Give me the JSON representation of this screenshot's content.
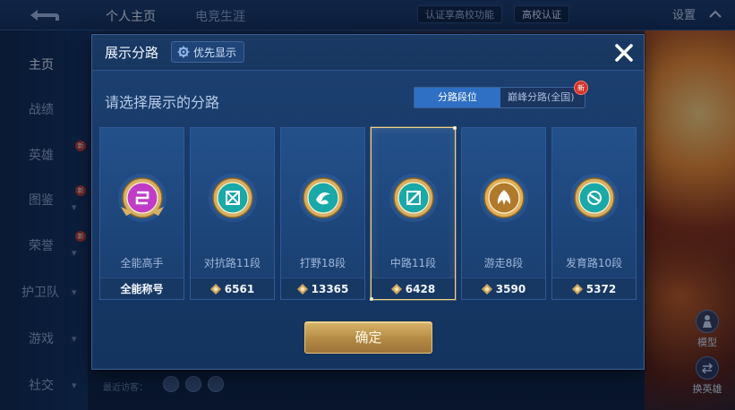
{
  "topbar": {
    "tabs": [
      "个人主页",
      "电竞生涯"
    ],
    "campus_promo": "认证享高校功能",
    "campus_cert": "高校认证",
    "settings": "设置"
  },
  "sidebar": {
    "items": [
      {
        "label": "主页"
      },
      {
        "label": "战绩"
      },
      {
        "label": "英雄",
        "badge": "新"
      },
      {
        "label": "图鉴",
        "badge": "新"
      },
      {
        "label": "荣誉",
        "badge": "新"
      },
      {
        "label": "护卫队"
      },
      {
        "label": "游戏"
      },
      {
        "label": "社交"
      }
    ]
  },
  "visitors": {
    "label": "最近访客："
  },
  "right_buttons": {
    "model": "模型",
    "switch_hero": "换英雄"
  },
  "modal": {
    "title": "展示分路",
    "priority_label": "优先显示",
    "prompt": "请选择展示的分路",
    "toggle": {
      "on": "分路段位",
      "off": "巅峰分路(全国)",
      "badge": "新"
    },
    "confirm": "确定",
    "cards": [
      {
        "name": "全能高手",
        "score": "全能称号",
        "color": "#c03cc8",
        "icon": "allround-icon"
      },
      {
        "name": "对抗路11段",
        "score": "6561",
        "color": "#18a9a8",
        "icon": "clash-lane-icon"
      },
      {
        "name": "打野18段",
        "score": "13365",
        "color": "#18a9a8",
        "icon": "jungle-icon"
      },
      {
        "name": "中路11段",
        "score": "6428",
        "color": "#18a9a8",
        "icon": "mid-lane-icon",
        "selected": true
      },
      {
        "name": "游走8段",
        "score": "3590",
        "color": "#b07a2c",
        "icon": "roam-icon"
      },
      {
        "name": "发育路10段",
        "score": "5372",
        "color": "#18a9a8",
        "icon": "farm-lane-icon"
      }
    ]
  },
  "colors": {
    "accent_blue": "#2f6fc4",
    "gold": "#d8b46a",
    "selected_border": "#f2d28a"
  }
}
